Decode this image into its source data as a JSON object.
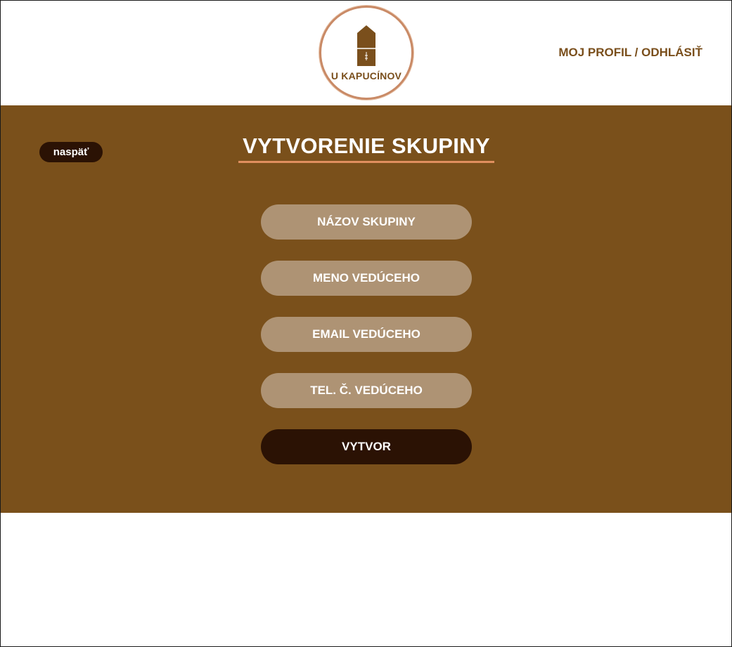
{
  "header": {
    "logo_text": "U KAPUCÍNOV",
    "profile_link": "MOJ PROFIL / ODHLÁSIŤ"
  },
  "main": {
    "back_label": "naspäť",
    "title": "VYTVORENIE SKUPINY",
    "fields": [
      {
        "placeholder": "NÁZOV SKUPINY"
      },
      {
        "placeholder": "MENO VEDÚCEHO"
      },
      {
        "placeholder": "EMAIL VEDÚCEHO"
      },
      {
        "placeholder": "TEL. Č. VEDÚCEHO"
      }
    ],
    "submit_label": "VYTVOR"
  },
  "colors": {
    "brand_brown": "#7a501b",
    "dark_brown": "#2b1204",
    "field_beige": "#ae9374",
    "accent_orange": "#e08f5f"
  },
  "icons": {
    "logo": "capuchin-silhouette-icon"
  }
}
